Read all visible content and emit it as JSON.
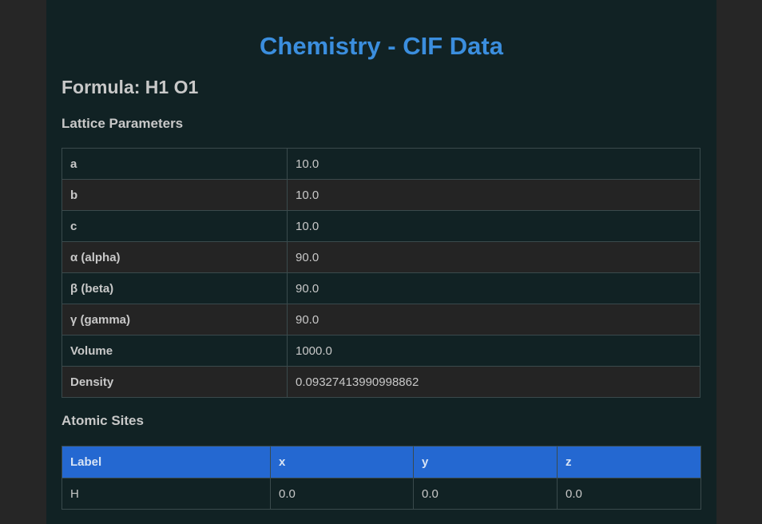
{
  "page_title": "Chemistry - CIF Data",
  "formula": "Formula: H1 O1",
  "lattice": {
    "title": "Lattice Parameters",
    "rows": [
      {
        "key": "a",
        "value": "10.0"
      },
      {
        "key": "b",
        "value": "10.0"
      },
      {
        "key": "c",
        "value": "10.0"
      },
      {
        "key": "α (alpha)",
        "value": "90.0"
      },
      {
        "key": "β (beta)",
        "value": "90.0"
      },
      {
        "key": "γ (gamma)",
        "value": "90.0"
      },
      {
        "key": "Volume",
        "value": "1000.0"
      },
      {
        "key": "Density",
        "value": "0.09327413990998862"
      }
    ]
  },
  "atomic_sites": {
    "title": "Atomic Sites",
    "headers": [
      "Label",
      "x",
      "y",
      "z"
    ],
    "rows": [
      [
        "H",
        "0.0",
        "0.0",
        "0.0"
      ]
    ]
  },
  "colors": {
    "accent": "#3b8ede",
    "header_bg": "#2468d1",
    "page_bg": "#112224",
    "outer_bg": "#262626"
  }
}
